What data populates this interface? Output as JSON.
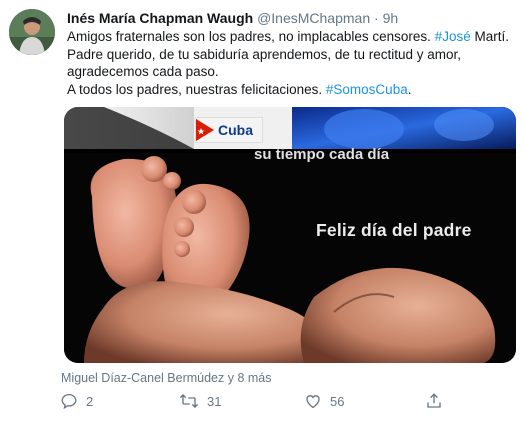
{
  "tweet": {
    "author_name": "Inés María Chapman Waugh",
    "handle": "@InesMChapman",
    "separator": "·",
    "time": "9h",
    "text_part1": "Amigos fraternales son los padres, no implacables censores. ",
    "hashtag1": "#José",
    "text_part2": " Martí.\nPadre querido, de tu sabiduría aprendemos, de tu rectitud y amor, agradecemos cada paso.\nA todos los padres, nuestras felicitaciones.  ",
    "hashtag2": "#SomosCuba",
    "text_part3": "."
  },
  "media": {
    "logo_text": "Cuba",
    "overlay_top": "su tiempo cada día",
    "overlay_main": "Feliz día del padre"
  },
  "footer": {
    "retweeted_by": "Miguel Díaz-Canel Bermúdez y 8 más"
  },
  "actions": {
    "reply_count": "2",
    "retweet_count": "31",
    "like_count": "56"
  }
}
